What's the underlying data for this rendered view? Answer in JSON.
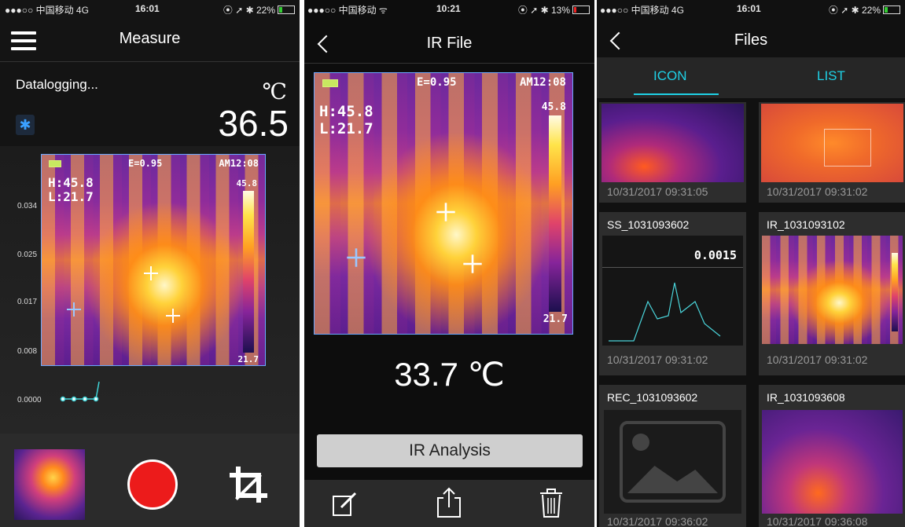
{
  "screen1": {
    "status": {
      "carrier": "●●●○○ 中国移动  4G",
      "time": "16:01",
      "right": "⦿ ➚ ✱ 22%"
    },
    "title": "Measure",
    "datalogging": "Datalogging...",
    "unit": "℃",
    "reading": "36.5",
    "y_ticks": [
      "0.034",
      "0.025",
      "0.017",
      "0.008",
      "0.0000"
    ],
    "thermal": {
      "emissivity": "E=0.95",
      "clock": "AM12:08",
      "high": "H:45.8",
      "low": "L:21.7",
      "bar_max": "45.8",
      "bar_min": "21.7"
    }
  },
  "screen2": {
    "status": {
      "carrier": "●●●○○ 中国移动 ᯤ",
      "time": "10:21",
      "right": "⦿ ➚ ✱ 13%"
    },
    "title": "IR File",
    "thermal": {
      "emissivity": "E=0.95",
      "clock": "AM12:08",
      "high": "H:45.8",
      "low": "L:21.7",
      "bar_max": "45.8",
      "bar_min": "21.7"
    },
    "temperature": "33.7 ℃",
    "analysis_button": "IR  Analysis"
  },
  "screen3": {
    "status": {
      "carrier": "●●●○○ 中国移动  4G",
      "time": "16:01",
      "right": "⦿ ➚ ✱ 22%"
    },
    "title": "Files",
    "tabs": [
      "ICON",
      "LIST"
    ],
    "active_tab": "ICON",
    "files": [
      {
        "name": "",
        "date": "10/31/2017 09:31:05"
      },
      {
        "name": "",
        "date": "10/31/2017 09:31:02"
      },
      {
        "name": "SS_1031093602",
        "date": "10/31/2017 09:31:02",
        "reading": "0.0015"
      },
      {
        "name": "IR_1031093102",
        "date": "10/31/2017 09:31:02"
      },
      {
        "name": "REC_1031093602",
        "date": "10/31/2017 09:36:02"
      },
      {
        "name": "IR_1031093608",
        "date": "10/31/2017 09:36:08"
      }
    ]
  },
  "icons": {
    "menu": "hamburger-icon",
    "bluetooth": "bluetooth-icon",
    "record": "record-icon",
    "crop": "crop-icon",
    "edit": "edit-icon",
    "share": "share-icon",
    "trash": "trash-icon",
    "back": "back-chevron-icon",
    "image": "image-placeholder-icon"
  },
  "colors": {
    "accent": "#1fd1e6",
    "record": "#ec1b1b",
    "bluetooth": "#3aa0ff"
  }
}
